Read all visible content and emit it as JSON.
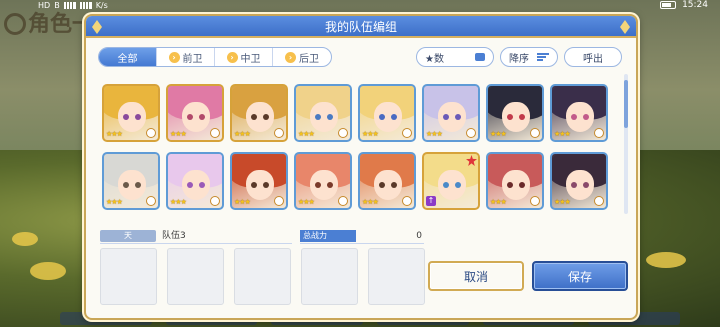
{
  "status_bar": {
    "left_labels": [
      "HD",
      "B",
      "K/s"
    ],
    "time": "15:24"
  },
  "background": {
    "title": "角色一"
  },
  "dialog": {
    "title": "我的队伍编组",
    "filter_tabs": [
      {
        "label": "全部",
        "active": true
      },
      {
        "label": "前卫",
        "active": false
      },
      {
        "label": "中卫",
        "active": false
      },
      {
        "label": "后卫",
        "active": false
      }
    ],
    "sort_key_label": "★数",
    "order_label": "降序",
    "call_label": "呼出",
    "characters": [
      {
        "hair": "#e9b53d",
        "eyes": "#8a4a9c",
        "stars": "★★★",
        "frame": "gold"
      },
      {
        "hair": "#e07aa5",
        "eyes": "#b24a6a",
        "stars": "★★★",
        "frame": "gold"
      },
      {
        "hair": "#d9a140",
        "eyes": "#5a3a2a",
        "stars": "★★★",
        "frame": "gold"
      },
      {
        "hair": "#f0d28a",
        "eyes": "#4a7ac2",
        "stars": "★★★",
        "frame": "blue"
      },
      {
        "hair": "#f2d27a",
        "eyes": "#4a6ac2",
        "stars": "★★★",
        "frame": "blue"
      },
      {
        "hair": "#c8c2e8",
        "eyes": "#6a5ab8",
        "stars": "★★★",
        "frame": "blue"
      },
      {
        "hair": "#2a2a3a",
        "eyes": "#c23a4a",
        "stars": "★★★",
        "frame": "blue"
      },
      {
        "hair": "#3a2e4a",
        "eyes": "#c25a8a",
        "stars": "★★★",
        "frame": "blue"
      },
      {
        "hair": "#d8d8d4",
        "eyes": "#6a5a4a",
        "stars": "★★★",
        "frame": "blue"
      },
      {
        "hair": "#e8c8ec",
        "eyes": "#9a5ab8",
        "stars": "★★★",
        "frame": "blue"
      },
      {
        "hair": "#c84a2a",
        "eyes": "#5a3a2a",
        "stars": "★★★",
        "frame": "blue"
      },
      {
        "hair": "#e8866a",
        "eyes": "#7a3a2a",
        "stars": "★★★",
        "frame": "blue"
      },
      {
        "hair": "#e07a4a",
        "eyes": "#5a3a2a",
        "stars": "★★★",
        "frame": "blue"
      },
      {
        "hair": "#f3dc8a",
        "eyes": "#4a8ac8",
        "stars": "",
        "frame": "gold",
        "badge": true,
        "mark": "↑"
      },
      {
        "hair": "#c85a5a",
        "eyes": "#6a2a2a",
        "stars": "★★★",
        "frame": "blue"
      },
      {
        "hair": "#3a2a3a",
        "eyes": "#8a4a6a",
        "stars": "★★★",
        "frame": "blue"
      },
      {
        "hair": "#b8c8e8",
        "eyes": "#4a6ab8",
        "stars": "",
        "frame": "blue"
      },
      {
        "hair": "#d8b88a",
        "eyes": "#5a3a2a",
        "stars": "",
        "frame": "gold"
      },
      {
        "hair": "#6ab8e0",
        "eyes": "#3a5a8a",
        "stars": "",
        "frame": "blue"
      },
      {
        "hair": "#e8e0d0",
        "eyes": "#6a6a6a",
        "stars": "",
        "frame": "blue"
      },
      {
        "hair": "#e0884a",
        "eyes": "#5a3a2a",
        "stars": "",
        "frame": "gold"
      },
      {
        "hair": "#e8b8c8",
        "eyes": "#8a4a6a",
        "stars": "",
        "frame": "blue"
      },
      {
        "hair": "#c8a8e0",
        "eyes": "#6a4a9a",
        "stars": "",
        "frame": "blue"
      },
      {
        "hair": "#b8b8d8",
        "eyes": "#5a5a8a",
        "stars": "",
        "frame": "blue"
      }
    ],
    "team_tag": "天",
    "team_name": "队伍3",
    "power_label": "总战力",
    "power_value": "0",
    "slots": 5,
    "cancel_label": "取消",
    "save_label": "保存"
  }
}
